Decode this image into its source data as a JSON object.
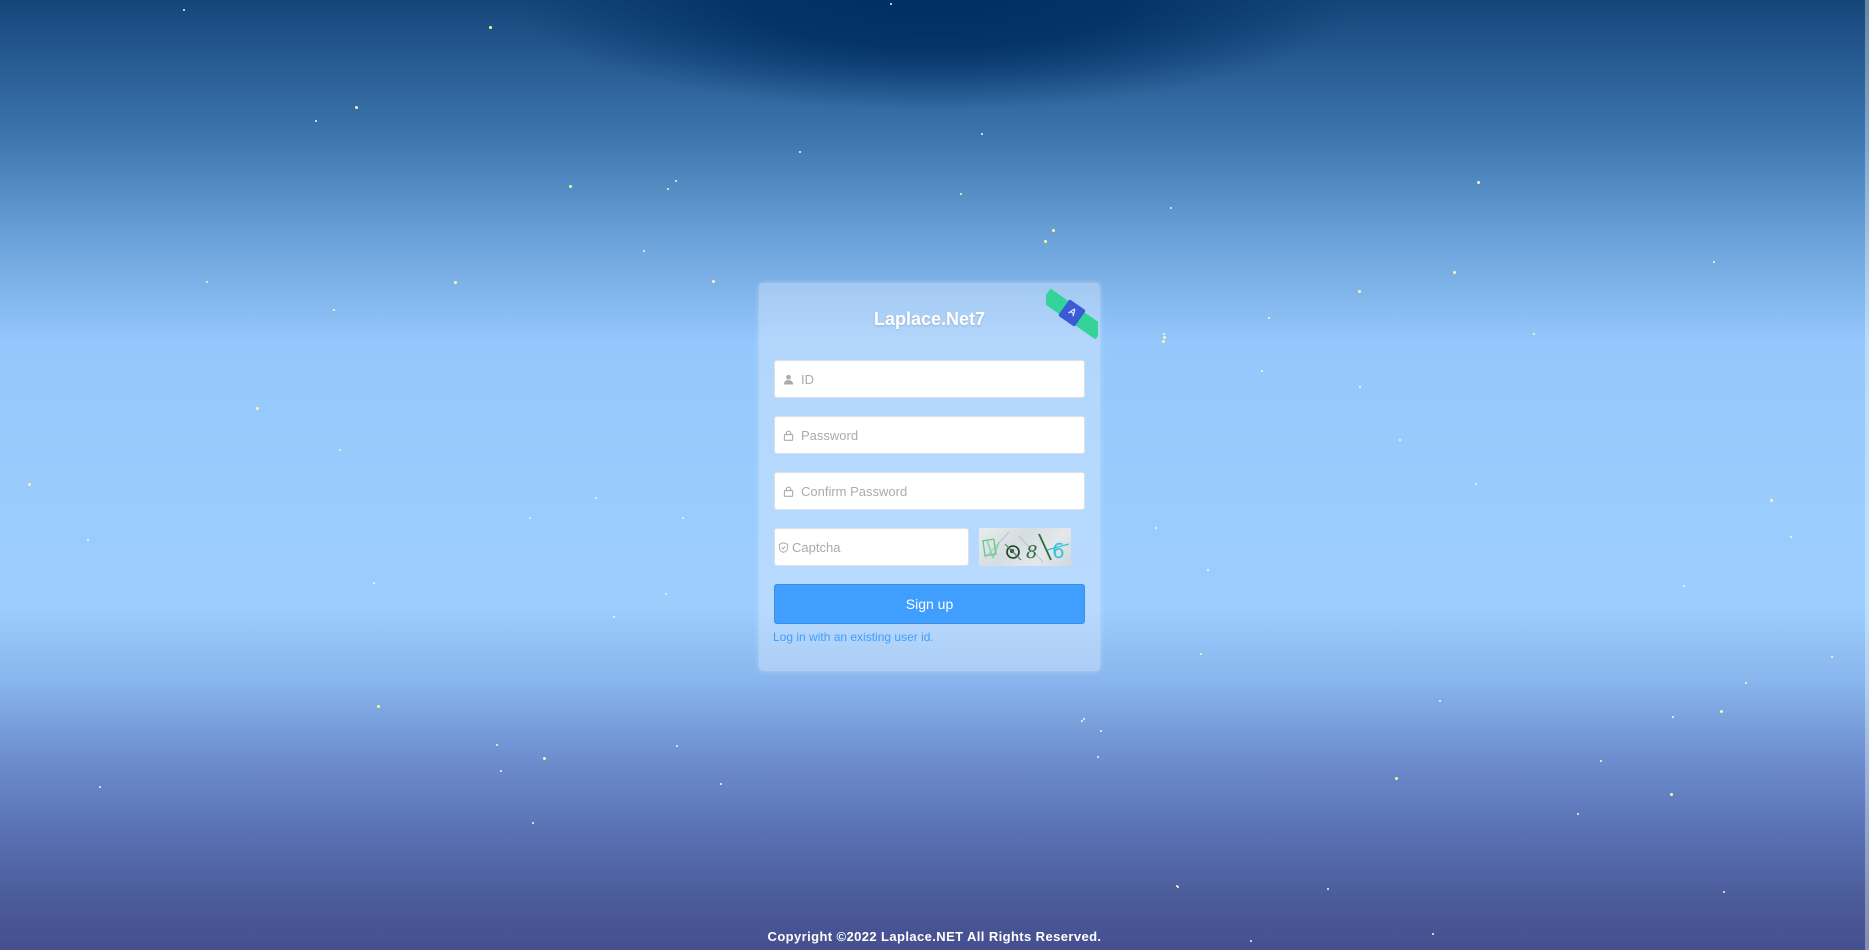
{
  "app": {
    "title": "Laplace.Net7",
    "language_badge": "A"
  },
  "form": {
    "id_placeholder": "ID",
    "password_placeholder": "Password",
    "confirm_password_placeholder": "Confirm Password",
    "captcha_placeholder": "Captcha",
    "captcha_text": "4 9 8 \\ 6",
    "signup_label": "Sign up",
    "login_link": "Log in with an existing user id."
  },
  "footer": {
    "copyright": "Copyright ©2022 Laplace.NET All Rights Reserved."
  },
  "colors": {
    "primary": "#409eff",
    "badge_strip": "#34d399",
    "badge_box": "#3b5bd6"
  },
  "icons": {
    "id": "user-icon",
    "password": "lock-icon",
    "confirm_password": "lock-icon",
    "captcha": "shield-check-icon",
    "language": "translate-icon"
  }
}
